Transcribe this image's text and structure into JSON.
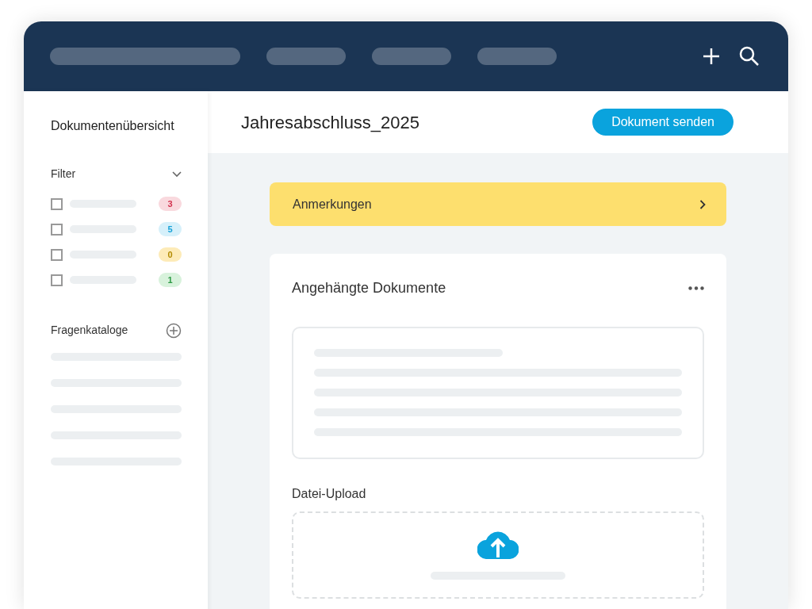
{
  "sidebar": {
    "title": "Dokumentenübersicht",
    "filter": {
      "label": "Filter",
      "expanded": true,
      "items": [
        {
          "checked": false,
          "count": "3",
          "color": "#f9d9de"
        },
        {
          "checked": false,
          "count": "5",
          "color": "#d6f0fa"
        },
        {
          "checked": false,
          "count": "0",
          "color": "#fdebb8"
        },
        {
          "checked": false,
          "count": "1",
          "color": "#d8f2dc"
        }
      ]
    },
    "catalogs": {
      "label": "Fragenkataloge"
    }
  },
  "document": {
    "title": "Jahresabschluss_2025",
    "send_button": "Dokument senden"
  },
  "notes": {
    "label": "Anmerkungen"
  },
  "attachments": {
    "title": "Angehängte Dokumente"
  },
  "upload": {
    "label": "Datei-Upload"
  }
}
